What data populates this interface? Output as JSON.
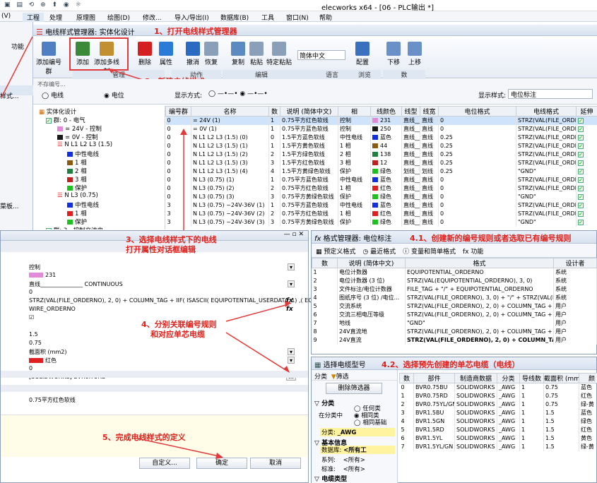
{
  "window": {
    "title": "elecworks x64 - [06 - PLC输出 *]"
  },
  "menu": [
    "(V)",
    "工程",
    "处理",
    "原理图",
    "绘图(D)",
    "修改...",
    "导入/导出(I)",
    "数据库(B)",
    "工具",
    "窗口(N)",
    "帮助"
  ],
  "manager": {
    "title": "电线样式管理器: 实体化设计"
  },
  "annotations": [
    "1、打开电线样式管理器",
    "2、新建电线样式",
    "3、选择电线样式下的电线",
    "打开属性对话框编辑",
    "4、分别关联编号规则",
    "和对应单芯电缆",
    "5、完成电线样式的定义",
    "4.1、创建新的编号规则或者选取已有编号规则",
    "4.2、选择预先创建的单芯电缆（电线）"
  ],
  "ribbon": {
    "buttons": [
      "添加编号群",
      "添加",
      "添加多线制",
      "删除",
      "属性",
      "撤消",
      "恢复",
      "复制",
      "粘贴",
      "特定粘贴",
      "配置",
      "下移",
      "上移"
    ],
    "groups": [
      "管理",
      "动作",
      "编辑",
      "语言",
      "浏览",
      "数"
    ],
    "language": "简体中文"
  },
  "left_fragments": {
    "top": "功能",
    "style": "样式...",
    "menu": "菜板..."
  },
  "filter": {
    "label": "不存编号...",
    "opt_wire": "电线",
    "opt_potential": "电位",
    "display_label": "显示方式:",
    "display_style_label": "显示样式:",
    "display_style_value": "电位标注"
  },
  "tree": [
    "实体化设计",
    "群: 0 - 电气",
    "= 24V - 控制",
    "= 0V - 控制",
    "N L1 L2 L3 (1.5)",
    "中性电线",
    "1 相",
    "2 相",
    "3 相",
    "保护",
    "N L3 (0.75)",
    "中性电线",
    "1 相",
    "保护",
    "群: 3 - 控制交流电",
    "N L3 (0.75) - 24V 36V"
  ],
  "grid": {
    "headers": [
      "编号群",
      "名称",
      "数",
      "说明 (简体中文)",
      "相",
      "线颜色",
      "线型",
      "线宽",
      "电位格式",
      "电线格式",
      "延伸"
    ],
    "rows": [
      [
        "0",
        "= 24V (1)",
        "1",
        "0.75平方红色软线",
        "控制",
        "231",
        "直线",
        "0",
        "STRZ(VAL(FILE_ORDERNO)...",
        "WIRE_ORDERNO",
        "✓",
        "#e08ad8"
      ],
      [
        "0",
        "= 0V (1)",
        "1",
        "0.75平方蓝色软线",
        "控制",
        "250",
        "直线",
        "0",
        "STRZ(VAL(FILE_ORDERNO)...",
        "WIRE_ORDERNO",
        "✓",
        "#1a1a1a"
      ],
      [
        "0",
        "N L1 L2 L3 (1.5) (0)",
        "0",
        "1.5平方蓝色软线",
        "中性电线",
        "蓝色",
        "直线",
        "0.25",
        "STRZ(VAL(FILE_ORDERNO)...",
        "WIRE_ORDERNO",
        "✓",
        "#1030e0"
      ],
      [
        "0",
        "N L1 L2 L3 (1.5) (1)",
        "1",
        "1.5平方黄色软线",
        "1 相",
        "44",
        "直线",
        "0.25",
        "STRZ(VAL(FILE_ORDERNO)...",
        "WIRE_ORDERNO",
        "✓",
        "#8a5a10"
      ],
      [
        "0",
        "N L1 L2 L3 (1.5) (2)",
        "2",
        "1.5平方绿色软线",
        "2 相",
        "138",
        "直线",
        "0.25",
        "STRZ(VAL(FILE_ORDERNO)...",
        "WIRE_ORDERNO",
        "✓",
        "#208040"
      ],
      [
        "0",
        "N L1 L2 L3 (1.5) (3)",
        "3",
        "1.5平方红色软线",
        "3 相",
        "12",
        "直线",
        "0.25",
        "STRZ(VAL(FILE_ORDERNO)...",
        "WIRE_ORDERNO",
        "✓",
        "#c02020"
      ],
      [
        "0",
        "N L1 L2 L3 (1.5) (4)",
        "4",
        "1.5平方黄绿色软线",
        "保护",
        "绿色",
        "划线",
        "0.25",
        "\"GND\"",
        "WIRE_ORDERNO",
        "✓",
        "#20c020"
      ],
      [
        "0",
        "N L3 (0.75) (1)",
        "1",
        "0.75平方蓝色软线",
        "中性电线",
        "蓝色",
        "直线",
        "0",
        "STRZ(VAL(FILE_ORDERNO)...",
        "WIRE_ORDERNO",
        "✓",
        "#1030e0"
      ],
      [
        "0",
        "N L3 (0.75) (2)",
        "2",
        "0.75平方红色软线",
        "1 相",
        "红色",
        "直线",
        "0",
        "STRZ(VAL(FILE_ORDERNO)...",
        "WIRE_ORDERNO",
        "✓",
        "#e02020"
      ],
      [
        "0",
        "N L3 (0.75) (3)",
        "3",
        "0.75平方黄绿色软线",
        "保护",
        "绿色",
        "直线",
        "0",
        "\"GND\"",
        "WIRE_ORDERNO",
        "✓",
        "#20c020"
      ],
      [
        "3",
        "N L3 (0.75) ~24V-36V (1)",
        "1",
        "0.75平方蓝色软线",
        "中性电线",
        "蓝色",
        "直线",
        "0",
        "STRZ(VAL(FILE_ORDERNO)...",
        "WIRE_ORDERNO",
        "✓",
        "#1030e0"
      ],
      [
        "3",
        "N L3 (0.75) ~24V-36V (2)",
        "2",
        "0.75平方红色软线",
        "1 相",
        "红色",
        "直线",
        "0",
        "STRZ(VAL(FILE_ORDERNO)...",
        "WIRE_ORDERNO",
        "✓",
        "#e02020"
      ],
      [
        "3",
        "N L3 (0.75) ~24V-36V (3)",
        "3",
        "0.75平方黄绿色软线",
        "保护",
        "绿色",
        "直线",
        "0",
        "\"GND\"",
        "WIRE_ORDERNO",
        "✓",
        "#20c020"
      ]
    ]
  },
  "props": {
    "rows": [
      "控制",
      "231",
      "直线_______________ CONTINUOUS",
      "0",
      "STRZ(VAL(FILE_ORDERNO), 2, 0) + COLUMN_TAG + IIF( ISASCII( EQUIPOTENTIAL_USERDATA_1) ,( EQUIP",
      "WIRE_ORDERNO",
      "☑",
      "",
      "1.5",
      "0.75",
      "截面积 (mm2)",
      "红色",
      "0",
      "[SOLIDWORKS] BVR0.75RD",
      "",
      "",
      "0.75平方红色软线"
    ],
    "custom_btn": "自定义...",
    "ok": "确定",
    "cancel": "取消"
  },
  "format_mgr": {
    "title": "格式管理器: 电位标注",
    "tabs": [
      "预定义格式",
      "最近格式",
      "变量和简单格式",
      "功能"
    ],
    "headers": [
      "数",
      "说明 (简体中文)",
      "格式",
      "设计者"
    ],
    "rows": [
      [
        "1",
        "电位计数器",
        "EQUIPOTENTIAL_ORDERNO",
        "系统"
      ],
      [
        "2",
        "电位计数器 (3 位)",
        "STRZ(VAL(EQUIPOTENTIAL_ORDERNO), 3, 0)",
        "系统"
      ],
      [
        "3",
        "文件标注/电位计数器",
        "FILE_TAG + \"/\" + EQUIPOTENTIAL_ORDERNO",
        "系统"
      ],
      [
        "4",
        "图纸序号 (3 位) /电位...",
        "STRZ(VAL(FILE_ORDERNO), 3, 0) + \"/\" + STRZ(VAL(EQUI...",
        "系统"
      ],
      [
        "5",
        "交流系统",
        "STRZ(VAL(FILE_ORDERNO), 2, 0) + COLUMN_TAG + SW...",
        "用户"
      ],
      [
        "6",
        "交流三相电压等级",
        "STRZ(VAL(FILE_ORDERNO), 2, 0) + COLUMN_TAG + SW...",
        "用户"
      ],
      [
        "7",
        "地线",
        "\"GND\"",
        "用户"
      ],
      [
        "8",
        "24V直流地",
        "STRZ(VAL(FILE_ORDERNO), 2, 0) + COLUMN_TAG + IIF( ...",
        "用户"
      ],
      [
        "9",
        "24V直流",
        "STRZ(VAL(FILE_ORDERNO), 2, 0) + COLUMN_TAG + ...",
        "用户"
      ]
    ]
  },
  "cable_sel": {
    "title": "选择电缆型号",
    "tabs": [
      "分类",
      "筛选"
    ],
    "delete_filter": "删除筛选器",
    "sections": {
      "category": "分类",
      "in_category": "在分类中",
      "any": "任何类",
      "this": "相同类",
      "same_base": "相同基础",
      "category_val_label": "分类:",
      "category_val": "_AWG",
      "basic": "基本信息",
      "database_label": "数据库:",
      "database_val": "<所有工",
      "series_label": "系列:",
      "series_val": "<所有>",
      "standard_label": "标准:",
      "standard_val": "<所有>",
      "cable_type": "电缆类型"
    },
    "headers": [
      "数",
      "部件",
      "制造商数据",
      "分类",
      "导线数",
      "截面积 (mm2)",
      "颜"
    ],
    "rows": [
      [
        "0",
        "BVR0.75BU",
        "SOLIDWORKS",
        "_AWG",
        "1",
        "0.75",
        "蓝色"
      ],
      [
        "1",
        "BVR0.75RD",
        "SOLIDWORKS",
        "_AWG",
        "1",
        "0.75",
        "红色"
      ],
      [
        "2",
        "BVR0.75YL/GN",
        "SOLIDWORKS",
        "_AWG",
        "1",
        "0.75",
        "绿-黄"
      ],
      [
        "3",
        "BVR1.5BU",
        "SOLIDWORKS",
        "_AWG",
        "1",
        "1.5",
        "蓝色"
      ],
      [
        "4",
        "BVR1.5GN",
        "SOLIDWORKS",
        "_AWG",
        "1",
        "1.5",
        "绿色"
      ],
      [
        "5",
        "BVR1.5RD",
        "SOLIDWORKS",
        "_AWG",
        "1",
        "1.5",
        "红色"
      ],
      [
        "6",
        "BVR1.5YL",
        "SOLIDWORKS",
        "_AWG",
        "1",
        "1.5",
        "黄色"
      ],
      [
        "7",
        "BVR1.5YL/GN",
        "SOLIDWORKS",
        "_AWG",
        "1",
        "1.5",
        "绿-黄"
      ]
    ]
  }
}
